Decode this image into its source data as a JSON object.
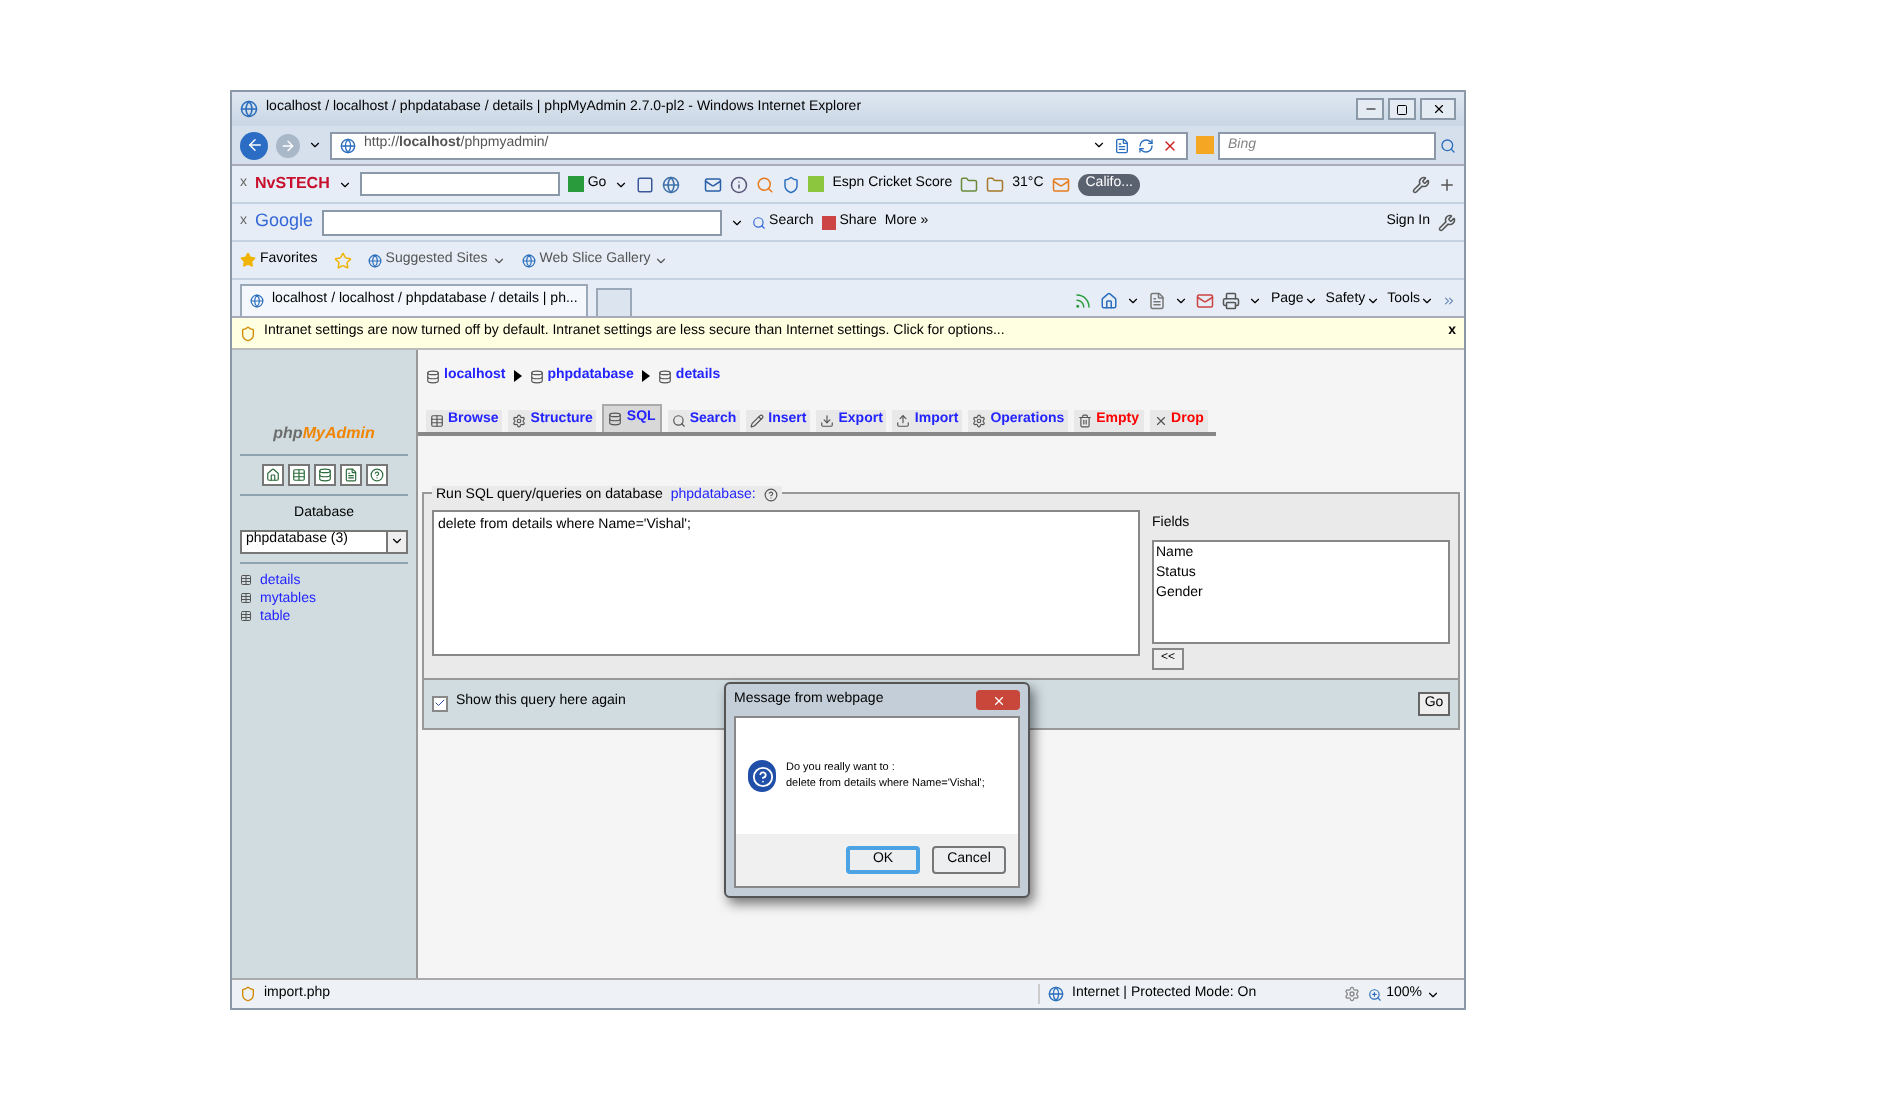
{
  "window": {
    "title": "localhost / localhost / phpdatabase / details | phpMyAdmin 2.7.0-pl2 - Windows Internet Explorer"
  },
  "address_bar": {
    "url": "http://**localhost**/phpmyadmin/",
    "search_placeholder": "Bing"
  },
  "nvstech_bar": {
    "close": "x",
    "brand": "NvSTECH",
    "go": "Go",
    "score": "Espn Cricket Score",
    "weather": "31°C",
    "radio": "Califo..."
  },
  "google_bar": {
    "close": "x",
    "brand": "Google",
    "search": "Search",
    "share": "Share",
    "more": "More »",
    "sign_in": "Sign In"
  },
  "favorites_bar": {
    "favorites": "Favorites",
    "links": [
      "Suggested Sites",
      "Web Slice Gallery"
    ]
  },
  "tabs": [
    {
      "label": "localhost / localhost / phpdatabase / details | ph...",
      "selected": true
    }
  ],
  "command_bar": [
    "Page",
    "Safety",
    "Tools"
  ],
  "info_bar": {
    "message": "Intranet settings are now turned off by default. Intranet settings are less secure than Internet settings. Click for options...",
    "close": "x"
  },
  "sidebar": {
    "logo_prefix": "php",
    "logo_suffix": "MyAdmin",
    "database_label": "Database",
    "database_select": "phpdatabase (3)",
    "tables": [
      "details",
      "mytables",
      "table"
    ]
  },
  "breadcrumb": [
    "localhost",
    "phpdatabase",
    "details"
  ],
  "db_tabs": [
    {
      "label": "Browse",
      "selected": false,
      "kind": "normal"
    },
    {
      "label": "Structure",
      "selected": false,
      "kind": "normal"
    },
    {
      "label": "SQL",
      "selected": true,
      "kind": "normal"
    },
    {
      "label": "Search",
      "selected": false,
      "kind": "normal"
    },
    {
      "label": "Insert",
      "selected": false,
      "kind": "normal"
    },
    {
      "label": "Export",
      "selected": false,
      "kind": "normal"
    },
    {
      "label": "Import",
      "selected": false,
      "kind": "normal"
    },
    {
      "label": "Operations",
      "selected": false,
      "kind": "normal"
    },
    {
      "label": "Empty",
      "selected": false,
      "kind": "danger"
    },
    {
      "label": "Drop",
      "selected": false,
      "kind": "danger"
    }
  ],
  "sql_form": {
    "legend": "Run SQL query/queries on database",
    "legend_link": "phpdatabase:",
    "query": "delete from details where Name='Vishal';",
    "fields_label": "Fields",
    "fields": [
      "Name",
      "Status",
      "Gender"
    ],
    "insert_button": "<<",
    "show_again": {
      "label": "Show this query here again",
      "checked": true
    },
    "go": "Go"
  },
  "dialog": {
    "title": "Message from webpage",
    "lines": [
      "Do you really want to :",
      "delete from details where Name='Vishal';"
    ],
    "buttons": [
      {
        "label": "OK",
        "default": true
      },
      {
        "label": "Cancel",
        "default": false
      }
    ]
  },
  "status_bar": {
    "left": "import.php",
    "zone": "Internet | Protected Mode: On",
    "zoom": "100%"
  }
}
